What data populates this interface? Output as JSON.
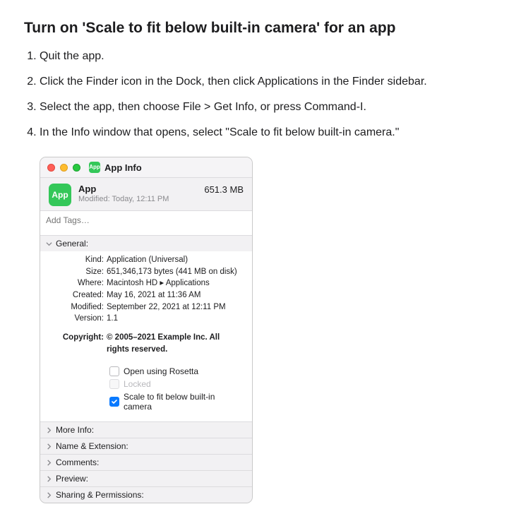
{
  "page": {
    "title": "Turn on 'Scale to fit below built-in camera' for an app"
  },
  "steps": [
    "Quit the app.",
    "Click the Finder icon in the Dock, then click Applications in the Finder sidebar.",
    "Select the app, then choose File > Get Info, or press Command-I.",
    "In the Info window that opens, select \"Scale to fit below built-in camera.\""
  ],
  "window": {
    "title": "App Info",
    "icon_label": "App",
    "app_name": "App",
    "modified_line": "Modified: Today, 12:11 PM",
    "size": "651.3 MB",
    "tags_placeholder": "Add Tags…"
  },
  "sections": {
    "general_label": "General:",
    "more_info_label": "More Info:",
    "name_ext_label": "Name & Extension:",
    "comments_label": "Comments:",
    "preview_label": "Preview:",
    "sharing_label": "Sharing & Permissions:"
  },
  "general": {
    "kind_k": "Kind:",
    "kind_v": "Application (Universal)",
    "size_k": "Size:",
    "size_v": "651,346,173 bytes (441 MB on disk)",
    "where_k": "Where:",
    "where_v": "Macintosh HD ▸ Applications",
    "created_k": "Created:",
    "created_v": "May 16, 2021 at 11:36 AM",
    "modified_k": "Modified:",
    "modified_v": "September 22, 2021 at 12:11 PM",
    "version_k": "Version:",
    "version_v": "1.1",
    "copyright_k": "Copyright:",
    "copyright_v": "© 2005–2021 Example Inc. All rights reserved."
  },
  "checkboxes": {
    "rosetta": "Open using Rosetta",
    "locked": "Locked",
    "scale": "Scale to fit below built-in camera"
  }
}
